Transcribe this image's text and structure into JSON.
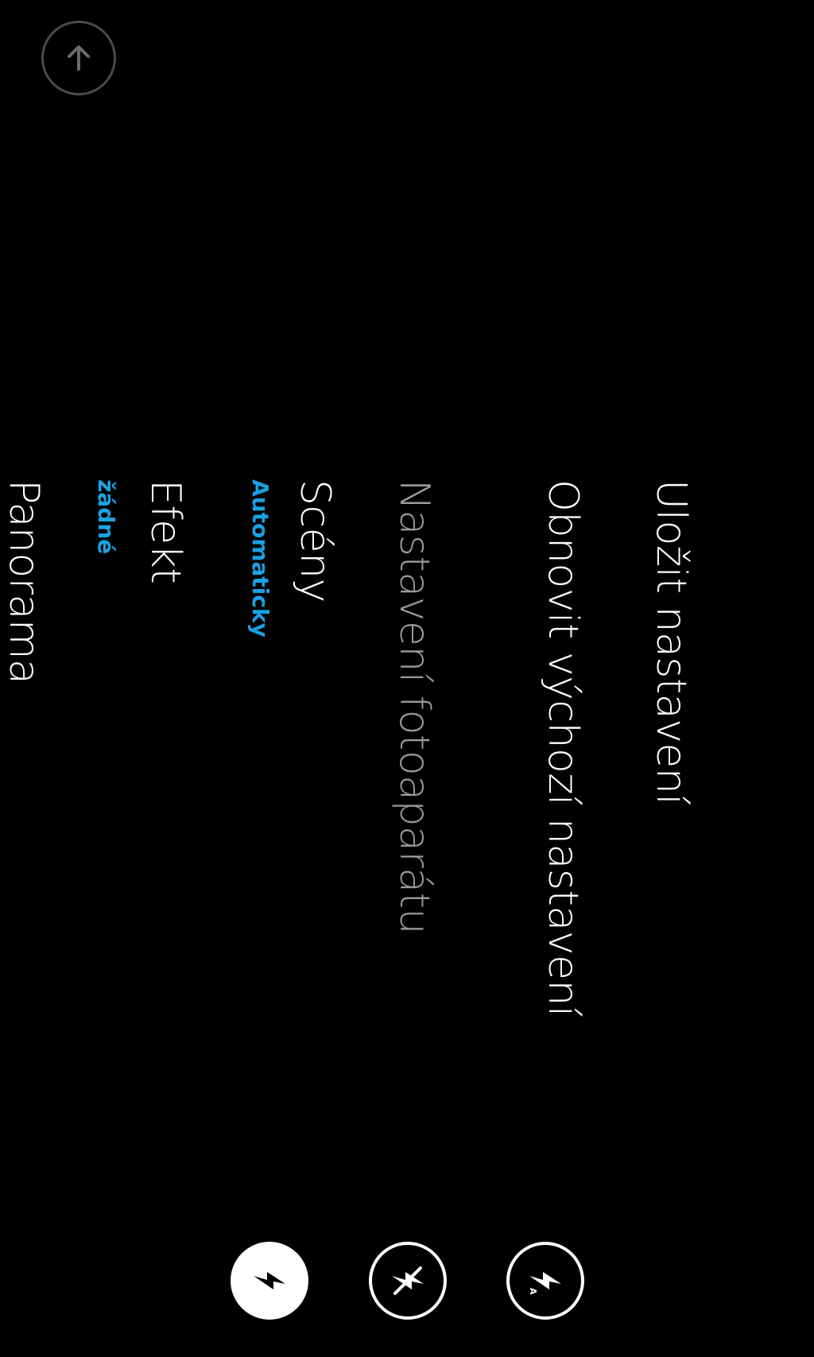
{
  "menu": {
    "save_settings": "Uložit nastavení",
    "restore_defaults": "Obnovit výchozí nastavení",
    "camera_settings_header": "Nastavení fotoaparátu",
    "scenes": {
      "label": "Scény",
      "value": "Automaticky"
    },
    "effect": {
      "label": "Efekt",
      "value": "žádné"
    },
    "panorama": {
      "label": "Panorama"
    }
  },
  "icons": {
    "back": "arrow-up-icon",
    "flash_auto": "flash-auto-icon",
    "flash_off": "flash-off-icon",
    "flash_on": "flash-on-icon"
  },
  "colors": {
    "background": "#000000",
    "text": "#ffffff",
    "header": "#9a9a9a",
    "accent": "#1ba1e2",
    "button_border": "#4a4a4a"
  },
  "flash": {
    "selected": "flash_on"
  }
}
